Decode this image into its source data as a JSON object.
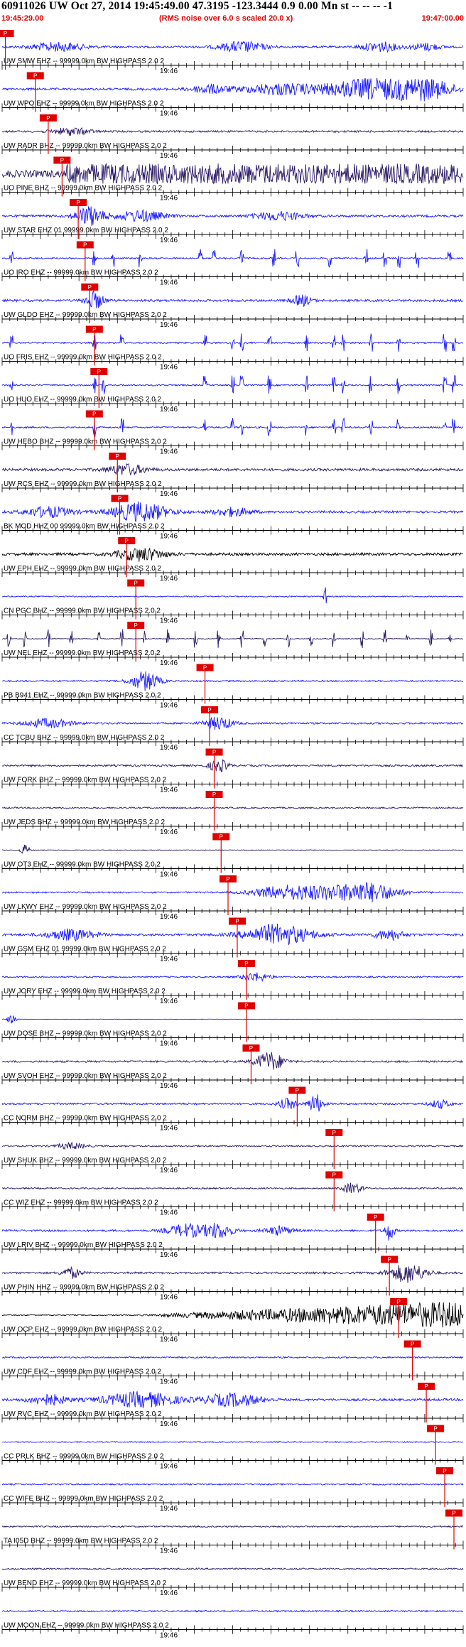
{
  "header": {
    "title": "60911026 UW Oct 27, 2014 19:45:49.00   47.3195 -123.3444  0.9 0.00 Mn st -- -- --   -1",
    "start_time": "19:45:29.00",
    "note": "(RMS noise over 6.0 s scaled 20.0 x)",
    "end_time": "19:47:00.00"
  },
  "colors": {
    "blue": "#1a1aff",
    "navy": "#2b1a66",
    "black": "#000000",
    "pick": "#e00000",
    "axis": "#000000"
  },
  "chart_data": {
    "type": "line",
    "x_axis_label": "19:46",
    "pick_label": "P",
    "channels": [
      {
        "label": "UW SMW EHZ -- 99999.0km BW  HIGHPASS  2.0  2",
        "color": "blue",
        "amp": 0.25,
        "pick": 0.007,
        "bursts": [
          [
            0.12,
            0.06,
            0.4
          ],
          [
            0.52,
            0.05,
            0.5
          ],
          [
            0.82,
            0.04,
            0.45
          ],
          [
            0.92,
            0.03,
            0.35
          ]
        ],
        "spikes": []
      },
      {
        "label": "UW WPO EHZ -- 99999.0km BW  HIGHPASS  2.0  2",
        "color": "blue",
        "amp": 0.3,
        "pick": 0.072,
        "bursts": [
          [
            0.45,
            0.04,
            0.4
          ],
          [
            0.6,
            0.08,
            0.5
          ],
          [
            0.8,
            0.1,
            0.95
          ],
          [
            0.92,
            0.06,
            0.8
          ]
        ],
        "spikes": []
      },
      {
        "label": "UW RADR BHZ -- 99999.0km BW  HIGHPASS  2.0  2",
        "color": "navy",
        "amp": 0.25,
        "pick": 0.1,
        "bursts": [
          [
            0.15,
            0.04,
            0.35
          ]
        ],
        "spikes": []
      },
      {
        "label": "UO PINE BHZ -- 99999.0km BW  HIGHPASS  2.0  2",
        "color": "navy",
        "amp": 0.95,
        "pick": 0.13,
        "bursts": [],
        "spikes": [],
        "full": [
          0.14,
          1.0
        ]
      },
      {
        "label": "UW STAR EHZ 01 99999.0km BW  HIGHPASS  2.0  2",
        "color": "blue",
        "amp": 0.3,
        "pick": 0.165,
        "bursts": [
          [
            0.19,
            0.03,
            0.9
          ],
          [
            0.3,
            0.05,
            0.5
          ],
          [
            0.6,
            0.05,
            0.4
          ]
        ],
        "spikes": []
      },
      {
        "label": "UO IRO EHZ -- 99999.0km BW  HIGHPASS  2.0  2",
        "color": "blue",
        "amp": 0.2,
        "pick": 0.18,
        "bursts": [],
        "spikes": [
          0.02,
          0.2,
          0.24,
          0.3,
          0.43,
          0.46,
          0.52,
          0.59,
          0.64,
          0.71,
          0.79,
          0.83,
          0.86,
          0.9,
          0.97
        ]
      },
      {
        "label": "UW GLDO EHZ -- 99999.0km BW  HIGHPASS  2.0  2",
        "color": "blue",
        "amp": 0.3,
        "pick": 0.19,
        "bursts": [
          [
            0.2,
            0.02,
            0.8
          ],
          [
            0.65,
            0.02,
            0.5
          ]
        ],
        "spikes": []
      },
      {
        "label": "UO FRIS EHZ -- 99999.0km BW  HIGHPASS  2.0  2",
        "color": "blue",
        "amp": 0.2,
        "pick": 0.2,
        "bursts": [],
        "spikes": [
          0.02,
          0.2,
          0.26,
          0.44,
          0.5,
          0.52,
          0.58,
          0.66,
          0.72,
          0.74,
          0.8,
          0.86,
          0.96,
          0.98
        ]
      },
      {
        "label": "UO HUO EHZ -- 99999.0km BW  HIGHPASS  2.0  2",
        "color": "blue",
        "amp": 0.2,
        "pick": 0.21,
        "bursts": [],
        "spikes": [
          0.02,
          0.2,
          0.22,
          0.44,
          0.5,
          0.52,
          0.58,
          0.66,
          0.72,
          0.74,
          0.8,
          0.86,
          0.96,
          0.98
        ]
      },
      {
        "label": "UW HEBO BHZ -- 99999.0km BW  HIGHPASS  2.0  2",
        "color": "blue",
        "amp": 0.2,
        "pick": 0.2,
        "bursts": [],
        "spikes": [
          0.02,
          0.2,
          0.26,
          0.44,
          0.5,
          0.52,
          0.58,
          0.66,
          0.72,
          0.74,
          0.8,
          0.86,
          0.96,
          0.98
        ]
      },
      {
        "label": "UW RCS EHZ -- 99999.0km BW  HIGHPASS  2.0  2",
        "color": "navy",
        "amp": 0.35,
        "pick": 0.25,
        "bursts": [
          [
            0.27,
            0.04,
            0.5
          ]
        ],
        "spikes": []
      },
      {
        "label": "BK MOD HHZ 00 99999.0km BW  HIGHPASS  2.0  2",
        "color": "blue",
        "amp": 0.3,
        "pick": 0.255,
        "bursts": [
          [
            0.3,
            0.06,
            0.9
          ],
          [
            0.1,
            0.05,
            0.5
          ],
          [
            0.5,
            0.04,
            0.4
          ]
        ],
        "spikes": []
      },
      {
        "label": "UW EPH EHZ -- 99999.0km BW  HIGHPASS  2.0  2",
        "color": "black",
        "amp": 0.35,
        "pick": 0.27,
        "bursts": [
          [
            0.3,
            0.05,
            0.6
          ]
        ],
        "spikes": []
      },
      {
        "label": "CN PGC BHZ -- 99999.0km BW  HIGHPASS  2.0  2",
        "color": "blue",
        "amp": 0.15,
        "pick": 0.29,
        "bursts": [],
        "spikes": [
          0.7
        ]
      },
      {
        "label": "UW NEL EHZ -- 99999.0km BW  HIGHPASS  2.0  2",
        "color": "navy",
        "amp": 0.1,
        "pick": 0.29,
        "bursts": [],
        "spikes": [
          0.015,
          0.05,
          0.1,
          0.15,
          0.21,
          0.26,
          0.31,
          0.36,
          0.42,
          0.47,
          0.52,
          0.57,
          0.62,
          0.67,
          0.72,
          0.78,
          0.83,
          0.88,
          0.93,
          0.97
        ]
      },
      {
        "label": "PB B941 EHZ -- 99999.0km BW  HIGHPASS  2.0  2",
        "color": "blue",
        "amp": 0.2,
        "pick": 0.44,
        "bursts": [
          [
            0.31,
            0.03,
            0.9
          ]
        ],
        "spikes": []
      },
      {
        "label": "CC TCBU BHZ -- 99999.0km BW  HIGHPASS  2.0  2",
        "color": "blue",
        "amp": 0.25,
        "pick": 0.45,
        "bursts": [
          [
            0.1,
            0.05,
            0.4
          ],
          [
            0.47,
            0.03,
            0.6
          ]
        ],
        "spikes": []
      },
      {
        "label": "UW FORK BHZ -- 99999.0km BW  HIGHPASS  2.0  2",
        "color": "navy",
        "amp": 0.25,
        "pick": 0.46,
        "bursts": [
          [
            0.47,
            0.02,
            0.6
          ]
        ],
        "spikes": []
      },
      {
        "label": "UW JEDS BHZ -- 99999.0km BW  HIGHPASS  2.0  2",
        "color": "navy",
        "amp": 0.2,
        "pick": 0.46,
        "bursts": [],
        "spikes": []
      },
      {
        "label": "UW OT3 EHZ -- 99999.0km BW  HIGHPASS  2.0  2",
        "color": "navy",
        "amp": 0.1,
        "pick": 0.475,
        "bursts": [
          [
            0.05,
            0.01,
            0.5
          ]
        ],
        "spikes": []
      },
      {
        "label": "UW LKWY EHZ -- 99999.0km BW  HIGHPASS  2.0  2",
        "color": "blue",
        "amp": 0.2,
        "pick": 0.49,
        "bursts": [
          [
            0.7,
            0.1,
            0.6
          ],
          [
            0.8,
            0.06,
            0.7
          ],
          [
            0.6,
            0.06,
            0.4
          ]
        ],
        "spikes": []
      },
      {
        "label": "UW GSM EHZ 01 99999.0km BW  HIGHPASS  2.0  2",
        "color": "blue",
        "amp": 0.3,
        "pick": 0.51,
        "bursts": [
          [
            0.6,
            0.07,
            0.95
          ],
          [
            0.15,
            0.05,
            0.5
          ],
          [
            0.84,
            0.03,
            0.5
          ]
        ],
        "spikes": []
      },
      {
        "label": "UW JORY EHZ -- 99999.0km BW  HIGHPASS  2.0  2",
        "color": "blue",
        "amp": 0.2,
        "pick": 0.53,
        "bursts": [
          [
            0.55,
            0.03,
            0.4
          ]
        ],
        "spikes": []
      },
      {
        "label": "UW DOSE BHZ -- 99999.0km BW  HIGHPASS  2.0  2",
        "color": "blue",
        "amp": 0.06,
        "pick": 0.53,
        "bursts": [
          [
            0.02,
            0.01,
            0.4
          ]
        ],
        "spikes": []
      },
      {
        "label": "UW SVOH EHZ -- 99999.0km BW  HIGHPASS  2.0  2",
        "color": "navy",
        "amp": 0.25,
        "pick": 0.54,
        "bursts": [
          [
            0.58,
            0.03,
            0.9
          ]
        ],
        "spikes": []
      },
      {
        "label": "CC NORM BHZ -- 99999.0km BW  HIGHPASS  2.0  2",
        "color": "blue",
        "amp": 0.25,
        "pick": 0.64,
        "bursts": [
          [
            0.68,
            0.015,
            0.9
          ],
          [
            0.62,
            0.02,
            0.5
          ],
          [
            0.95,
            0.02,
            0.4
          ]
        ],
        "spikes": []
      },
      {
        "label": "UW SHUK BHZ -- 99999.0km BW  HIGHPASS  2.0  2",
        "color": "navy",
        "amp": 0.2,
        "pick": 0.72,
        "bursts": [
          [
            0.15,
            0.03,
            0.3
          ]
        ],
        "spikes": []
      },
      {
        "label": "CC WIZ EHZ -- 99999.0km BW  HIGHPASS  2.0  2",
        "color": "navy",
        "amp": 0.2,
        "pick": 0.72,
        "bursts": [
          [
            0.76,
            0.02,
            0.5
          ]
        ],
        "spikes": []
      },
      {
        "label": "UW LRIV BHZ -- 99999.0km BW  HIGHPASS  2.0  2",
        "color": "blue",
        "amp": 0.25,
        "pick": 0.81,
        "bursts": [
          [
            0.4,
            0.04,
            0.6
          ],
          [
            0.47,
            0.03,
            0.7
          ],
          [
            0.84,
            0.01,
            0.9
          ],
          [
            0.6,
            0.03,
            0.4
          ]
        ],
        "spikes": []
      },
      {
        "label": "UW PHIN HHZ -- 99999.0km BW  HIGHPASS  2.0  2",
        "color": "navy",
        "amp": 0.25,
        "pick": 0.84,
        "bursts": [
          [
            0.88,
            0.04,
            0.9
          ],
          [
            0.15,
            0.02,
            0.5
          ]
        ],
        "spikes": []
      },
      {
        "label": "UW OCP EHZ -- 99999.0km BW  HIGHPASS  2.0  2",
        "color": "black",
        "amp": 0.15,
        "pick": 0.86,
        "bursts": [],
        "spikes": [],
        "ramp": [
          0.3,
          0.95
        ]
      },
      {
        "label": "UW CDF EHZ -- 99999.0km BW  HIGHPASS  2.0  2",
        "color": "blue",
        "amp": 0.2,
        "pick": 0.89,
        "bursts": [],
        "spikes": []
      },
      {
        "label": "UW RVC EHZ -- 99999.0km BW  HIGHPASS  2.0  2",
        "color": "blue",
        "amp": 0.3,
        "pick": 0.92,
        "bursts": [
          [
            0.3,
            0.08,
            0.7
          ],
          [
            0.5,
            0.06,
            0.6
          ],
          [
            0.1,
            0.04,
            0.5
          ]
        ],
        "spikes": []
      },
      {
        "label": "CC PRLK BHZ -- 99999.0km BW  HIGHPASS  2.0  2",
        "color": "blue",
        "amp": 0.15,
        "pick": 0.94,
        "bursts": [],
        "spikes": []
      },
      {
        "label": "CC WIFE BHZ -- 99999.0km BW  HIGHPASS  2.0  2",
        "color": "blue",
        "amp": 0.2,
        "pick": 0.96,
        "bursts": [],
        "spikes": []
      },
      {
        "label": "TA I05D BHZ -- 99999.0km BW  HIGHPASS  2.0  2",
        "color": "navy",
        "amp": 0.2,
        "pick": 0.98,
        "bursts": [],
        "spikes": []
      },
      {
        "label": "UW BEND EHZ -- 99999.0km BW  HIGHPASS  2.0  2",
        "color": "navy",
        "amp": 0.2,
        "pick": null,
        "bursts": [],
        "spikes": []
      },
      {
        "label": "UW MOON EHZ -- 99999.0km BW  HIGHPASS  2.0  2",
        "color": "blue",
        "amp": 0.2,
        "pick": null,
        "bursts": [],
        "spikes": []
      },
      {
        "label": "",
        "color": "blue",
        "amp": 0.15,
        "pick": null,
        "bursts": [
          [
            0.47,
            0.01,
            0.5
          ]
        ],
        "spikes": []
      }
    ]
  }
}
